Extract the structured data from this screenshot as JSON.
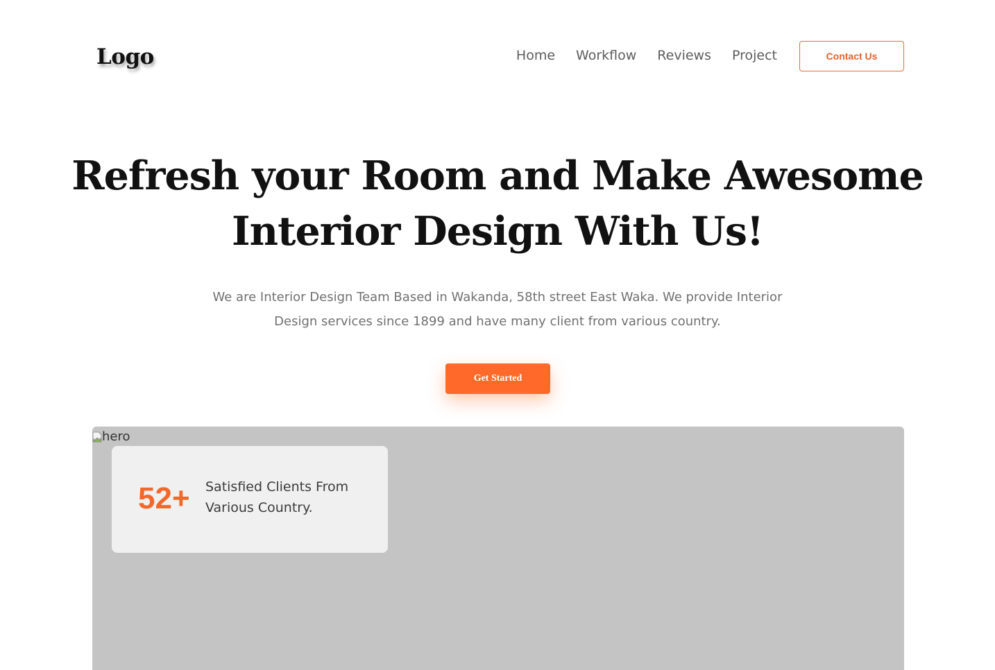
{
  "header": {
    "logo": "Logo",
    "nav": [
      "Home",
      "Workflow",
      "Reviews",
      "Project"
    ],
    "contact_label": "Contact Us"
  },
  "hero": {
    "title_line1": "Refresh your Room and Make Awesome",
    "title_line2": "Interior Design With Us!",
    "subtitle_line1": "We are Interior Design Team Based in Wakanda, 58th street East Waka. We provide Interior",
    "subtitle_line2": "Design services since 1899 and have many client from various country.",
    "cta_label": "Get Started",
    "image_alt": "hero"
  },
  "stat": {
    "number": "52+",
    "text_line1": "Satisfied Clients From",
    "text_line2": "Various Country."
  },
  "colors": {
    "accent": "#ff6a2a",
    "image_placeholder": "#c4c4c4",
    "card_bg": "#f0f0f0"
  },
  "icons": {
    "broken_image": "broken-image-icon"
  }
}
